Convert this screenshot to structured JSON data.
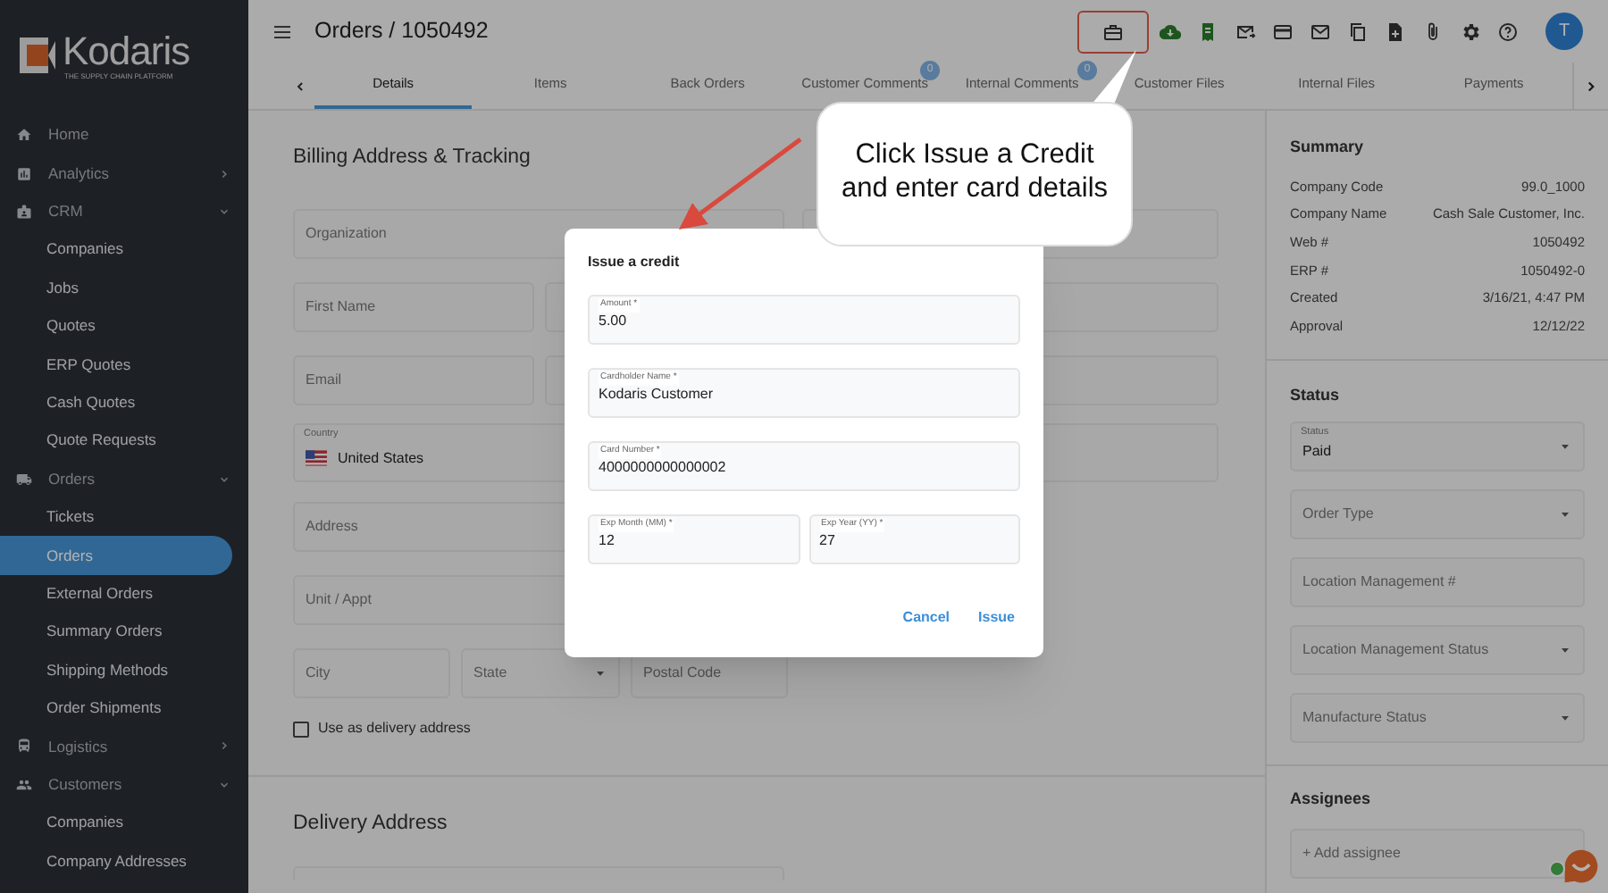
{
  "brand": {
    "name": "Kodaris",
    "tagline": "THE SUPPLY CHAIN PLATFORM"
  },
  "sidebar": {
    "items": [
      {
        "label": "Home",
        "kind": "link"
      },
      {
        "label": "Analytics",
        "kind": "group",
        "expanded": false
      },
      {
        "label": "CRM",
        "kind": "group",
        "expanded": true,
        "children": [
          {
            "label": "Companies",
            "selected": false
          },
          {
            "label": "Jobs",
            "selected": false
          },
          {
            "label": "Quotes",
            "selected": false
          },
          {
            "label": "ERP Quotes",
            "selected": false
          },
          {
            "label": "Cash Quotes",
            "selected": false
          },
          {
            "label": "Quote Requests",
            "selected": false
          }
        ]
      },
      {
        "label": "Orders",
        "kind": "group",
        "expanded": true,
        "children": [
          {
            "label": "Tickets",
            "selected": false
          },
          {
            "label": "Orders",
            "selected": true
          },
          {
            "label": "External Orders",
            "selected": false
          },
          {
            "label": "Summary Orders",
            "selected": false
          },
          {
            "label": "Shipping Methods",
            "selected": false
          },
          {
            "label": "Order Shipments",
            "selected": false
          }
        ]
      },
      {
        "label": "Logistics",
        "kind": "group",
        "expanded": false
      },
      {
        "label": "Customers",
        "kind": "group",
        "expanded": true,
        "children": [
          {
            "label": "Companies",
            "selected": false
          },
          {
            "label": "Company Addresses",
            "selected": false
          }
        ]
      }
    ]
  },
  "header": {
    "title": "Orders / 1050492",
    "avatar": "T"
  },
  "toolbar": [
    {
      "highlighted": true
    },
    {
      "highlighted": false
    },
    {
      "highlighted": false
    },
    {
      "highlighted": false
    },
    {
      "highlighted": false
    },
    {
      "highlighted": false
    },
    {
      "highlighted": false
    },
    {
      "highlighted": false
    },
    {
      "highlighted": false
    },
    {
      "highlighted": false
    },
    {
      "highlighted": false
    }
  ],
  "tabs": [
    {
      "label": "Details",
      "selected": true
    },
    {
      "label": "Items",
      "selected": false
    },
    {
      "label": "Back Orders",
      "selected": false
    },
    {
      "label": "Customer Comments",
      "selected": false,
      "badge": "0"
    },
    {
      "label": "Internal Comments",
      "selected": false,
      "badge": "0"
    },
    {
      "label": "Customer Files",
      "selected": false
    },
    {
      "label": "Internal Files",
      "selected": false
    },
    {
      "label": "Payments",
      "selected": false
    }
  ],
  "billing": {
    "title": "Billing Address & Tracking",
    "organization": {
      "placeholder": "Organization"
    },
    "first_name": {
      "placeholder": "First Name"
    },
    "email": {
      "placeholder": "Email"
    },
    "country": {
      "label": "Country",
      "value": "United States"
    },
    "address": {
      "placeholder": "Address"
    },
    "unit": {
      "placeholder": "Unit / Appt"
    },
    "city": {
      "placeholder": "City"
    },
    "state": {
      "placeholder": "State"
    },
    "postal_code": {
      "placeholder": "Postal Code"
    },
    "use_as_delivery": {
      "label": "Use as delivery address",
      "checked": false
    }
  },
  "delivery": {
    "title": "Delivery Address"
  },
  "summary": {
    "title": "Summary",
    "rows": [
      {
        "label": "Company Code",
        "value": "99.0_1000"
      },
      {
        "label": "Company Name",
        "value": "Cash Sale Customer, Inc."
      },
      {
        "label": "Web #",
        "value": "1050492"
      },
      {
        "label": "ERP #",
        "value": "1050492-0"
      },
      {
        "label": "Created",
        "value": "3/16/21, 4:47 PM"
      },
      {
        "label": "Approval",
        "value": "12/12/22"
      }
    ]
  },
  "status": {
    "title": "Status",
    "fields": [
      {
        "kind": "select",
        "label": "Status",
        "value": "Paid"
      },
      {
        "kind": "select",
        "placeholder": "Order Type"
      },
      {
        "kind": "text",
        "placeholder": "Location Management #"
      },
      {
        "kind": "select",
        "placeholder": "Location Management Status"
      },
      {
        "kind": "select",
        "placeholder": "Manufacture Status"
      }
    ]
  },
  "assignees": {
    "title": "Assignees",
    "placeholder": "+ Add assignee"
  },
  "dialog": {
    "title": "Issue a credit",
    "fields": [
      {
        "label": "Amount *",
        "value": "5.00"
      },
      {
        "label": "Cardholder Name *",
        "value": "Kodaris Customer"
      },
      {
        "label": "Card Number *",
        "value": "4000000000000002"
      }
    ],
    "exp_fields": [
      {
        "label": "Exp Month (MM) *",
        "value": "12"
      },
      {
        "label": "Exp Year (YY) *",
        "value": "27"
      }
    ],
    "buttons": [
      "Cancel",
      "Issue"
    ]
  },
  "callout": {
    "text": "Click Issue a Credit and enter card details"
  }
}
